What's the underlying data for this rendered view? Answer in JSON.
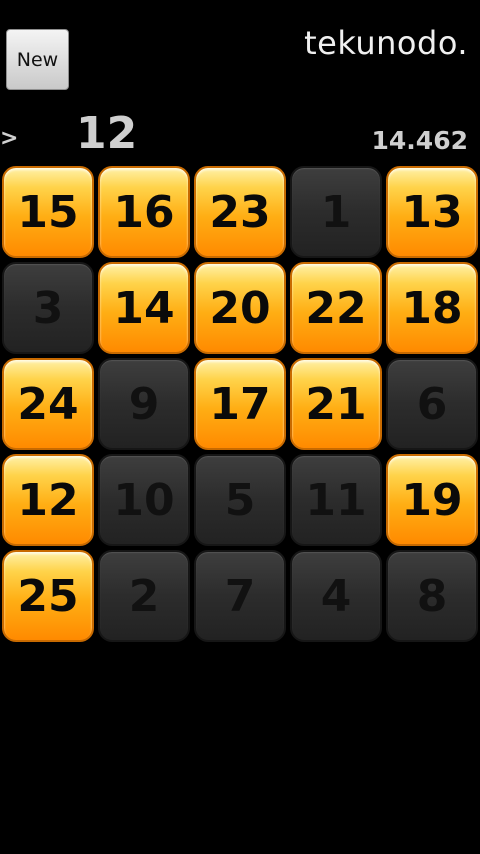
{
  "header": {
    "new_button_label": "New",
    "logo": "tekunodo."
  },
  "status": {
    "prompt": ">",
    "next_number": "12",
    "timer": "14.462"
  },
  "colors": {
    "active_tile": "#ffae14",
    "done_tile": "#2c2c2c",
    "background": "#000000"
  },
  "board": {
    "rows": 5,
    "cols": 5,
    "tiles": [
      {
        "number": "15",
        "state": "active"
      },
      {
        "number": "16",
        "state": "active"
      },
      {
        "number": "23",
        "state": "active"
      },
      {
        "number": "1",
        "state": "done"
      },
      {
        "number": "13",
        "state": "active"
      },
      {
        "number": "3",
        "state": "done"
      },
      {
        "number": "14",
        "state": "active"
      },
      {
        "number": "20",
        "state": "active"
      },
      {
        "number": "22",
        "state": "active"
      },
      {
        "number": "18",
        "state": "active"
      },
      {
        "number": "24",
        "state": "active"
      },
      {
        "number": "9",
        "state": "done"
      },
      {
        "number": "17",
        "state": "active"
      },
      {
        "number": "21",
        "state": "active"
      },
      {
        "number": "6",
        "state": "done"
      },
      {
        "number": "12",
        "state": "active"
      },
      {
        "number": "10",
        "state": "done"
      },
      {
        "number": "5",
        "state": "done"
      },
      {
        "number": "11",
        "state": "done"
      },
      {
        "number": "19",
        "state": "active"
      },
      {
        "number": "25",
        "state": "active"
      },
      {
        "number": "2",
        "state": "done"
      },
      {
        "number": "7",
        "state": "done"
      },
      {
        "number": "4",
        "state": "done"
      },
      {
        "number": "8",
        "state": "done"
      }
    ]
  }
}
